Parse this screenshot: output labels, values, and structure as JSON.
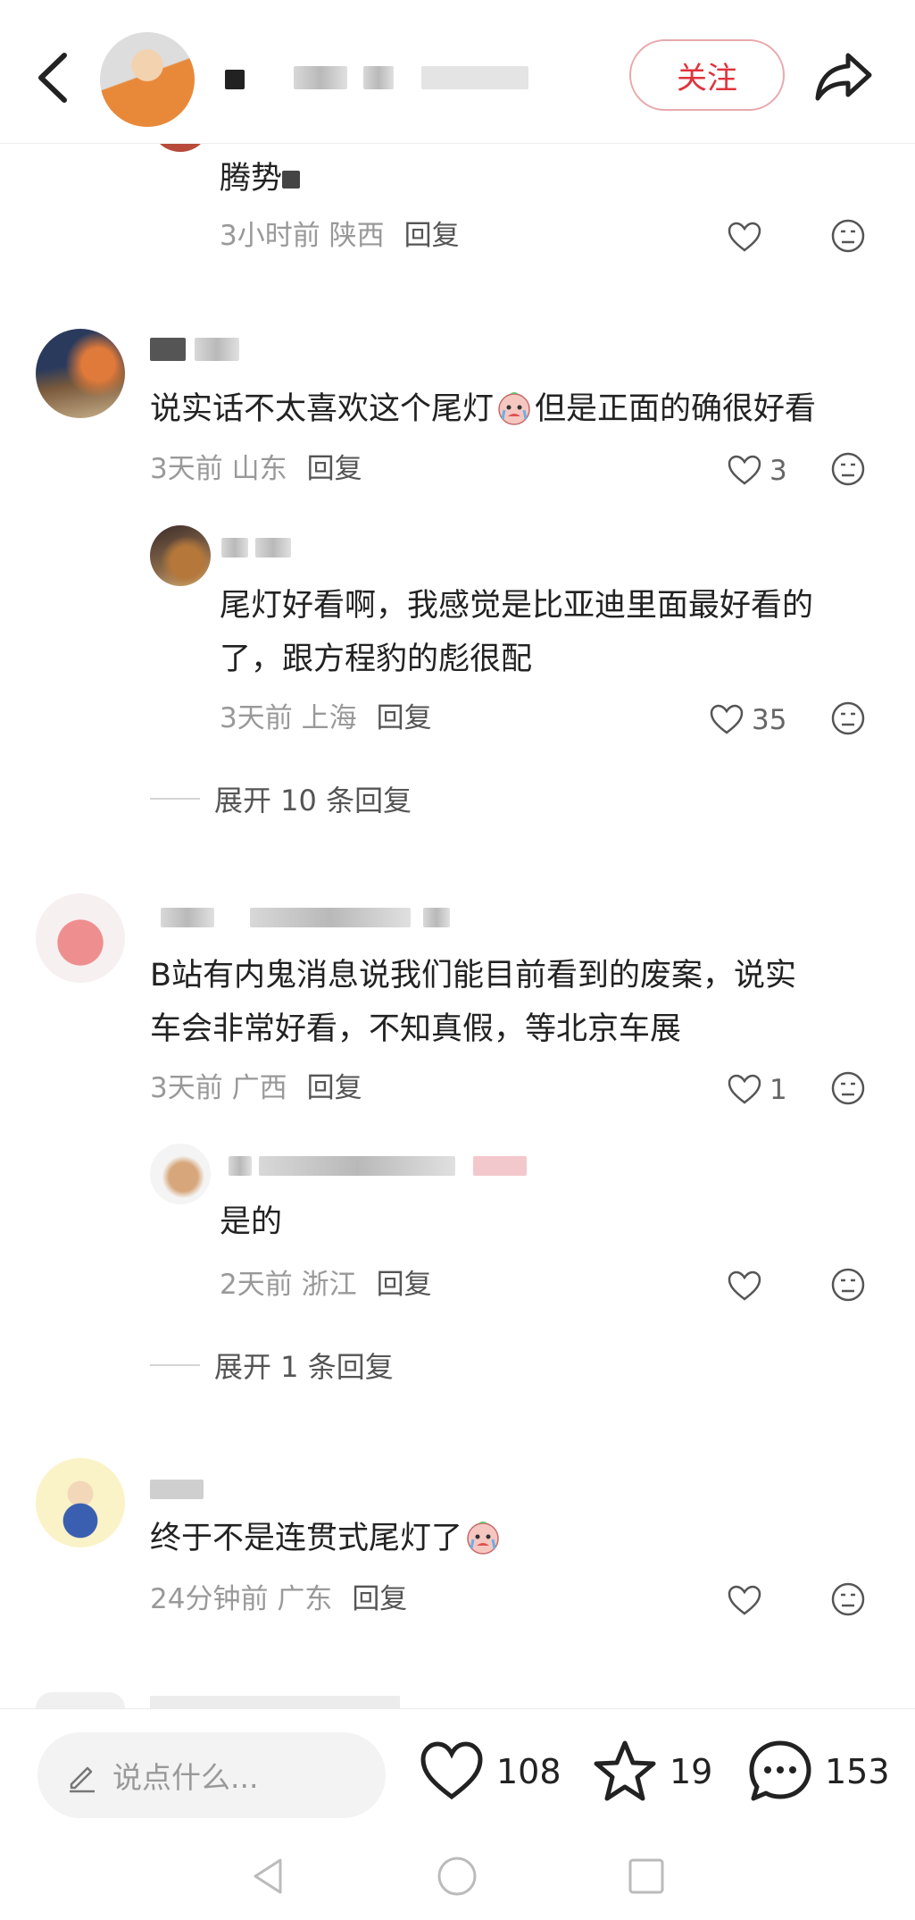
{
  "header": {
    "follow_label": "关注",
    "icons": [
      "chevron-left-icon",
      "avatar",
      "share-icon"
    ]
  },
  "comments": [
    {
      "text": "腾势",
      "time": "3小时前",
      "location": "陕西",
      "reply": "回复",
      "likes": null
    },
    {
      "text_before_emoji": "说实话不太喜欢这个尾灯",
      "text_after_emoji": "但是正面的确很好看",
      "time": "3天前",
      "location": "山东",
      "reply": "回复",
      "likes": "3"
    },
    {
      "text_line1": "尾灯好看啊，我感觉是比亚迪里面最好看的",
      "text_line2": "了，跟方程豹的彪很配",
      "time": "3天前",
      "location": "上海",
      "reply": "回复",
      "likes": "35"
    },
    {
      "text_line1": "B站有内鬼消息说我们能目前看到的废案，说实",
      "text_line2": "车会非常好看，不知真假，等北京车展",
      "time": "3天前",
      "location": "广西",
      "reply": "回复",
      "likes": "1"
    },
    {
      "text": "是的",
      "time": "2天前",
      "location": "浙江",
      "reply": "回复",
      "likes": null
    },
    {
      "text": "终于不是连贯式尾灯了",
      "time": "24分钟前",
      "location": "广东",
      "reply": "回复",
      "likes": null
    }
  ],
  "expand": {
    "first": "展开 10 条回复",
    "second": "展开 1 条回复"
  },
  "bottom": {
    "placeholder": "说点什么...",
    "likes": "108",
    "stars": "19",
    "comments": "153"
  },
  "colors": {
    "accent": "#e0333c",
    "meta": "#999999",
    "text": "#222222"
  }
}
